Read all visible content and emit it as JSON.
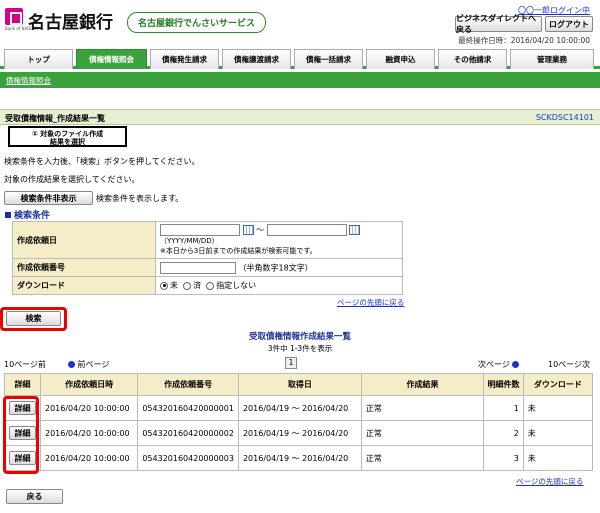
{
  "header": {
    "bank_name": "名古屋銀行",
    "logo_sub": "Bank of NAGOYA",
    "service_name": "名古屋銀行でんさいサービス",
    "user_name": "〇〇一郎ログイン中",
    "direct_button": "ビジネスダイレクトへ戻る",
    "logout_button": "ログアウト",
    "last_operation": "最終操作日時：2016/04/20 10:00:00"
  },
  "tabs": [
    {
      "label": "トップ"
    },
    {
      "label": "債権情報照会"
    },
    {
      "label": "債権発生請求"
    },
    {
      "label": "債権譲渡請求"
    },
    {
      "label": "債権一括請求"
    },
    {
      "label": "融資申込"
    },
    {
      "label": "その他請求"
    },
    {
      "label": "管理業務"
    }
  ],
  "subnav": {
    "link": "債権情報照会"
  },
  "page": {
    "title": "受取債権情報_作成結果一覧",
    "screen_code": "SCKDSC14101",
    "step_label_line1": "① 対象のファイル作成",
    "step_label_line2": "結果を選択",
    "instruction1": "検索条件を入力後、「検索」ボタンを押してください。",
    "instruction2": "対象の作成結果を選択してください。",
    "toggle_button": "検索条件非表示",
    "toggle_note": "検索条件を表示します。"
  },
  "search": {
    "section_title": "検索条件",
    "rows": [
      {
        "label": "作成依頼日",
        "tilde": "〜",
        "note1": "（YYYY/MM/DD）",
        "note2": "※本日から3日前までの作成結果が検索可能です。"
      },
      {
        "label": "作成依頼番号",
        "note": "（半角数字18文字）"
      },
      {
        "label": "ダウンロード",
        "options": [
          "未",
          "済",
          "指定しない"
        ]
      }
    ],
    "back_to_top": "ページの先頭に戻る",
    "search_button": "検索"
  },
  "results": {
    "title": "受取債権情報作成結果一覧",
    "count_text": "3件中 1-3件を表示",
    "prev10": "10ページ前",
    "prev": "前ページ",
    "page": "1",
    "next": "次ページ",
    "next10": "10ページ次",
    "headers": [
      "詳細",
      "作成依頼日時",
      "作成依頼番号",
      "取得日",
      "作成結果",
      "明細件数",
      "ダウンロード"
    ],
    "rows": [
      {
        "detail": "詳細",
        "datetime": "2016/04/20 10:00:00",
        "number": "054320160420000001",
        "period": "2016/04/19 〜 2016/04/20",
        "result": "正常",
        "count": "1",
        "download": "未"
      },
      {
        "detail": "詳細",
        "datetime": "2016/04/20 10:00:00",
        "number": "054320160420000002",
        "period": "2016/04/19 〜 2016/04/20",
        "result": "正常",
        "count": "2",
        "download": "未"
      },
      {
        "detail": "詳細",
        "datetime": "2016/04/20 10:00:00",
        "number": "054320160420000003",
        "period": "2016/04/19 〜 2016/04/20",
        "result": "正常",
        "count": "3",
        "download": "未"
      }
    ],
    "back_to_top": "ページの先頭に戻る"
  },
  "footer": {
    "back_button": "戻る"
  },
  "colors": {
    "accent_green": "#3aa23a",
    "highlight_red": "#e00000",
    "link_blue": "#1a33cc"
  }
}
